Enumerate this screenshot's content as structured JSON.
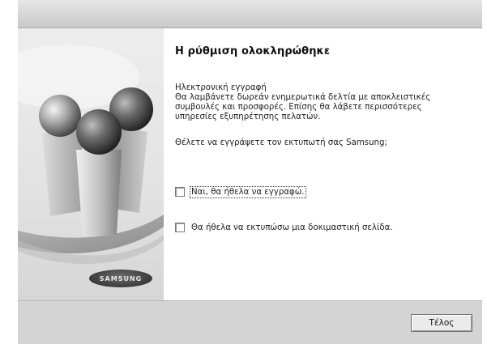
{
  "dialog": {
    "heading": "Η ρύθμιση ολοκληρώθηκε",
    "paragraph_lines": [
      "Ηλεκτρονική εγγραφή",
      "Θα λαμβάνετε δωρεάν ενημερωτικά δελτία με αποκλειστικές",
      "συμβουλές και προσφορές. Επίσης θα λάβετε περισσότερες",
      "υπηρεσίες εξυπηρέτησης πελατών."
    ],
    "question": "Θέλετε να εγγράψετε τον εκτυπωτή σας Samsung;",
    "options": [
      {
        "label": "Ναι, θα ήθελα να εγγραφώ.",
        "checked": false,
        "focused": true
      },
      {
        "label": "Θα ήθελα να εκτυπώσω μια δοκιμαστική σελίδα.",
        "checked": false,
        "focused": false
      }
    ],
    "finish_button": "Τέλος"
  },
  "brand": {
    "logo_text": "SAMSUNG"
  }
}
